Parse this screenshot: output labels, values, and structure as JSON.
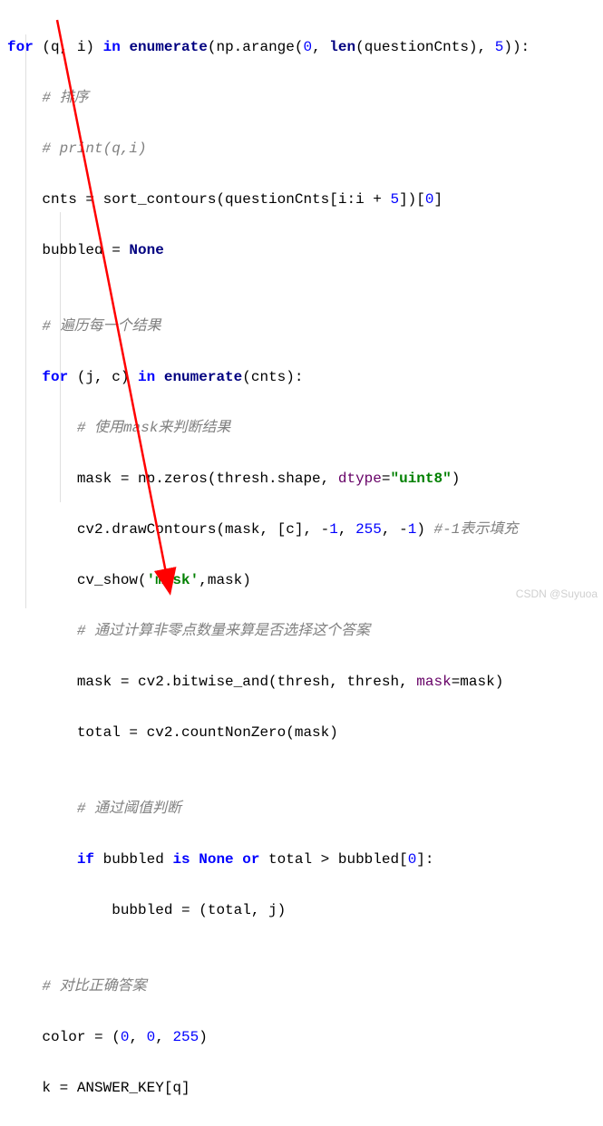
{
  "lines": {
    "l1a": "for",
    "l1b": " (q, i) ",
    "l1c": "in",
    "l1d": " ",
    "l1e": "enumerate",
    "l1f": "(np.arange(",
    "l1g": "0",
    "l1h": ", ",
    "l1i": "len",
    "l1j": "(questionCnts), ",
    "l1k": "5",
    "l1l": ")):",
    "l2": "    # 排序",
    "l3": "    # print(q,i)",
    "l4a": "    cnts = sort_contours(questionCnts[i:i + ",
    "l4b": "5",
    "l4c": "])[",
    "l4d": "0",
    "l4e": "]",
    "l5a": "    bubbled = ",
    "l5b": "None",
    "l6": "",
    "l7": "    # 遍历每一个结果",
    "l8a": "    for",
    "l8b": " (j, c) ",
    "l8c": "in",
    "l8d": " ",
    "l8e": "enumerate",
    "l8f": "(cnts):",
    "l9": "        # 使用mask来判断结果",
    "l10a": "        mask = np.zeros(thresh.shape, ",
    "l10b": "dtype",
    "l10c": "=",
    "l10d": "\"uint8\"",
    "l10e": ")",
    "l11a": "        cv2.drawContours(mask, [c], -",
    "l11b": "1",
    "l11c": ", ",
    "l11d": "255",
    "l11e": ", -",
    "l11f": "1",
    "l11g": ") ",
    "l11h": "#-1表示填充",
    "l12a": "        cv_show(",
    "l12b": "'mask'",
    "l12c": ",mask)",
    "l13": "        # 通过计算非零点数量来算是否选择这个答案",
    "l14a": "        mask = cv2.bitwise_and(thresh, thresh, ",
    "l14b": "mask",
    "l14c": "=mask)",
    "l15a": "        total = cv2.countNonZero(mask)",
    "l16": "",
    "l17": "        # 通过阈值判断",
    "l18a": "        if",
    "l18b": " bubbled ",
    "l18c": "is None or",
    "l18d": " total > bubbled[",
    "l18e": "0",
    "l18f": "]:",
    "l19a": "            bubbled = (total, j)",
    "l20": "",
    "l21": "    # 对比正确答案",
    "l22a": "    color = (",
    "l22b": "0",
    "l22c": ", ",
    "l22d": "0",
    "l22e": ", ",
    "l22f": "255",
    "l22g": ")",
    "l23a": "    k = ANSWER_KEY[q]"
  },
  "watermark": "CSDN @Suyuoa"
}
